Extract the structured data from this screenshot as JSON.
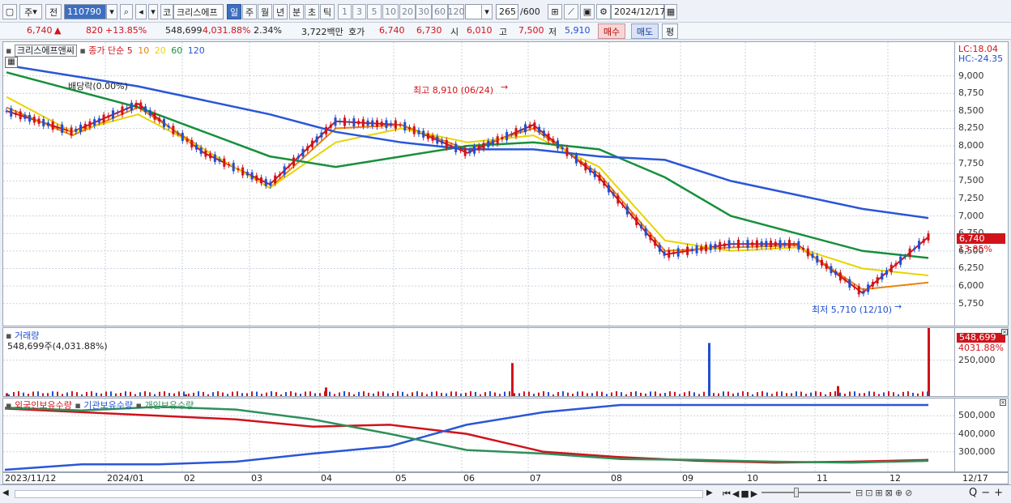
{
  "toolbar": {
    "market": "주",
    "market_mode": "전",
    "code": "110790",
    "name_prefix": "코",
    "name": "크리스에프",
    "periods": [
      "일",
      "주",
      "월",
      "년",
      "분",
      "초",
      "틱"
    ],
    "selected_period": "일",
    "intervals": [
      "1",
      "3",
      "5",
      "10",
      "20",
      "30",
      "60",
      "120"
    ],
    "count": "265",
    "count_max": "/600",
    "date": "2024/12/17"
  },
  "quote": {
    "price": "6,740",
    "change_arrow": "▲",
    "change": "820",
    "change_pct": "+13.85%",
    "volume": "548,699",
    "volume_pct": "4,031.88%",
    "turnover_pct": "2.34%",
    "amount": "3,722백만",
    "bid_label": "호가",
    "bid1": "6,740",
    "bid2": "6,730",
    "open_label": "시",
    "open": "6,010",
    "high_label": "고",
    "high": "7,500",
    "low_label": "저",
    "low": "5,910",
    "buy_button": "매수",
    "sell_button": "매도",
    "eval_button": "평"
  },
  "price_pane": {
    "stock_name": "크리스에프앤씨",
    "legend_label": "종가 단순",
    "ma_periods": [
      "5",
      "10",
      "20",
      "60",
      "120"
    ],
    "ma_colors": [
      "#d0131b",
      "#e8830a",
      "#e8d400",
      "#16903a",
      "#2a56d6"
    ],
    "lc": "LC:18.04",
    "hc": "HC:-24.35",
    "last_price_badge": "6,740",
    "last_change_badge": "13.85%",
    "dividend_note": "배당락(0.00%)",
    "high_annotation": "최고 8,910 (06/24)",
    "low_annotation": "최저 5,710 (12/10)"
  },
  "volume_pane": {
    "title": "거래량",
    "value_label": "548,699주(4,031.88%)",
    "badge_value": "548,699",
    "badge_pct": "4031.88%"
  },
  "holdings_pane": {
    "legend": [
      "외국인보유수량",
      "기관보유수량",
      "개인보유수량"
    ],
    "colors": [
      "#d0131b",
      "#2a56d6",
      "#2f8f5a"
    ]
  },
  "x_axis": {
    "labels": [
      "2023/11/12",
      "2024/01",
      "02",
      "03",
      "04",
      "05",
      "06",
      "07",
      "08",
      "09",
      "10",
      "11",
      "12"
    ],
    "right_label": "12/17"
  },
  "chart_data": [
    {
      "type": "line",
      "title": "",
      "xlabel": "",
      "ylabel": "",
      "ylim": [
        5550,
        9250
      ],
      "y_ticks": [
        5750,
        6000,
        6250,
        6500,
        6750,
        7000,
        7250,
        7500,
        7750,
        8000,
        8250,
        8500,
        8750,
        9000
      ],
      "x": [
        "2023/11",
        "2023/12",
        "2024/01",
        "2024/02",
        "2024/03",
        "2024/04",
        "2024/05",
        "2024/06",
        "2024/07",
        "2024/08",
        "2024/09",
        "2024/10",
        "2024/11",
        "2024/12",
        "2024/12/17"
      ],
      "series": [
        {
          "name": "5",
          "values": [
            8500,
            8200,
            8600,
            7900,
            7450,
            8350,
            8300,
            7900,
            8300,
            7550,
            6450,
            6600,
            6600,
            5900,
            6700
          ]
        },
        {
          "name": "10",
          "values": [
            8550,
            8150,
            8550,
            7950,
            7400,
            8250,
            8300,
            7950,
            8250,
            7600,
            6500,
            6550,
            6580,
            5950,
            6050
          ]
        },
        {
          "name": "20",
          "values": [
            8700,
            8200,
            8450,
            7950,
            7400,
            8050,
            8250,
            8050,
            8150,
            7700,
            6650,
            6500,
            6550,
            6250,
            6150
          ]
        },
        {
          "name": "60",
          "values": [
            9050,
            8800,
            8550,
            8200,
            7850,
            7700,
            7850,
            8000,
            8050,
            7950,
            7550,
            7000,
            6750,
            6500,
            6400
          ]
        },
        {
          "name": "120",
          "values": [
            9150,
            9000,
            8850,
            8650,
            8450,
            8200,
            8050,
            7950,
            7950,
            7850,
            7800,
            7500,
            7300,
            7100,
            6970
          ]
        }
      ]
    },
    {
      "type": "bar",
      "title": "거래량",
      "ylim": [
        0,
        440000
      ],
      "y_ticks": [
        250000
      ],
      "x": [
        "2023/11",
        "2024/02",
        "2024/04",
        "2024/06/24",
        "2024/09",
        "2024/11",
        "2024/12/17"
      ],
      "values": [
        20000,
        12000,
        60000,
        230000,
        370000,
        70000,
        548699
      ]
    },
    {
      "type": "line",
      "title": "",
      "ylim": [
        200000,
        560000
      ],
      "y_ticks": [
        300000,
        400000,
        500000
      ],
      "x": [
        "2023/11",
        "2024/01",
        "2024/03",
        "2024/04",
        "2024/05",
        "2024/06",
        "2024/07",
        "2024/08",
        "2024/09",
        "2024/10",
        "2024/11",
        "2024/12",
        "2024/12/17"
      ],
      "series": [
        {
          "name": "외국인보유수량",
          "values": [
            540000,
            520000,
            500000,
            480000,
            440000,
            450000,
            400000,
            300000,
            270000,
            250000,
            240000,
            245000,
            255000
          ]
        },
        {
          "name": "기관보유수량",
          "values": [
            200000,
            230000,
            230000,
            245000,
            290000,
            330000,
            450000,
            520000,
            560000,
            560000,
            560000,
            560000,
            560000
          ]
        },
        {
          "name": "개인보유수량",
          "values": [
            545000,
            530000,
            550000,
            535000,
            480000,
            400000,
            310000,
            290000,
            260000,
            255000,
            245000,
            240000,
            250000
          ]
        }
      ]
    }
  ]
}
